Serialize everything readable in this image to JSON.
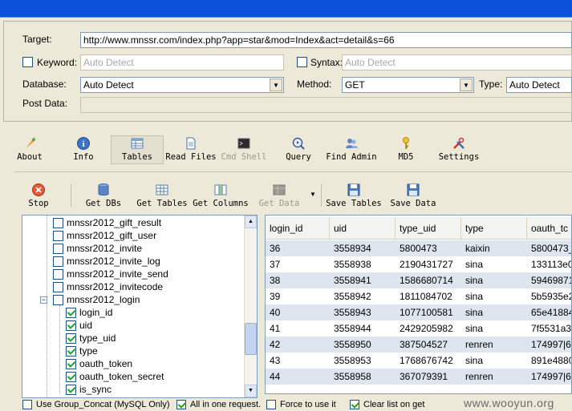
{
  "target": {
    "label": "Target:",
    "url": "http://www.mnssr.com/index.php?app=star&mod=Index&act=detail&s=66"
  },
  "keyword": {
    "label": "Keyword:",
    "placeholder": "Auto Detect"
  },
  "syntax": {
    "label": "Syntax:",
    "placeholder": "Auto Detect"
  },
  "database": {
    "label": "Database:",
    "value": "Auto Detect"
  },
  "method": {
    "label": "Method:",
    "value": "GET"
  },
  "type": {
    "label": "Type:",
    "value": "Auto Detect"
  },
  "post_data": {
    "label": "Post Data:",
    "value": ""
  },
  "toolbar": {
    "about": "About",
    "info": "Info",
    "tables": "Tables",
    "read_files": "Read Files",
    "cmd_shell": "Cmd Shell",
    "query": "Query",
    "find_admin": "Find Admin",
    "md5": "MD5",
    "settings": "Settings"
  },
  "actions": {
    "stop": "Stop",
    "get_dbs": "Get DBs",
    "get_tables": "Get Tables",
    "get_columns": "Get Columns",
    "get_data": "Get Data",
    "save_tables": "Save Tables",
    "save_data": "Save Data"
  },
  "tree": {
    "tables": [
      "mnssr2012_gift_result",
      "mnssr2012_gift_user",
      "mnssr2012_invite",
      "mnssr2012_invite_log",
      "mnssr2012_invite_send",
      "mnssr2012_invitecode",
      "mnssr2012_login"
    ],
    "columns": [
      "login_id",
      "uid",
      "type_uid",
      "type",
      "oauth_token",
      "oauth_token_secret",
      "is_sync"
    ]
  },
  "grid": {
    "headers": [
      "login_id",
      "uid",
      "type_uid",
      "type",
      "oauth_tc"
    ],
    "rows": [
      [
        "36",
        "3558934",
        "5800473",
        "kaixin",
        "5800473_"
      ],
      [
        "37",
        "3558938",
        "2190431727",
        "sina",
        "133113e0"
      ],
      [
        "38",
        "3558941",
        "1586680714",
        "sina",
        "59469871"
      ],
      [
        "39",
        "3558942",
        "1811084702",
        "sina",
        "5b5935e2"
      ],
      [
        "40",
        "3558943",
        "1077100581",
        "sina",
        "65e41884"
      ],
      [
        "41",
        "3558944",
        "2429205982",
        "sina",
        "7f5531a3"
      ],
      [
        "42",
        "3558950",
        "387504527",
        "renren",
        "174997|6"
      ],
      [
        "43",
        "3558953",
        "1768676742",
        "sina",
        "891e4880"
      ],
      [
        "44",
        "3558958",
        "367079391",
        "renren",
        "174997|6"
      ]
    ]
  },
  "options": {
    "group_concat": "Use Group_Concat (MySQL Only)",
    "all_in_one": "All in one request.",
    "force": "Force to use it",
    "clear_list": "Clear list on get"
  },
  "watermark": "www.wooyun.org"
}
